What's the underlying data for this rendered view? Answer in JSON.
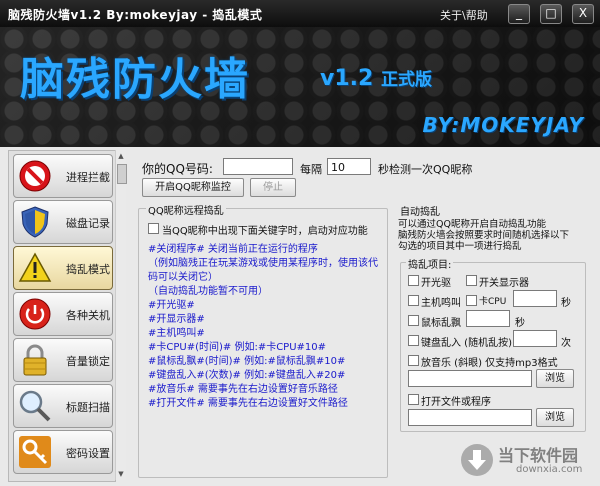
{
  "window": {
    "title": "脑残防火墙v1.2 By:mokeyjay - 捣乱模式",
    "help_label": "关于\\帮助",
    "min_label": "_",
    "max_label": "□",
    "close_label": "X"
  },
  "banner": {
    "logo": "脑残防火墙",
    "version": "v1.2",
    "edition": "正式版",
    "author": "BY:MOKEYJAY"
  },
  "sidebar": {
    "items": [
      {
        "label": "进程拦截",
        "icon": "stop-sign-icon"
      },
      {
        "label": "磁盘记录",
        "icon": "shield-icon"
      },
      {
        "label": "捣乱模式",
        "icon": "warning-icon",
        "selected": true
      },
      {
        "label": "各种关机",
        "icon": "power-icon"
      },
      {
        "label": "音量锁定",
        "icon": "padlock-icon"
      },
      {
        "label": "标题扫描",
        "icon": "magnifier-icon"
      },
      {
        "label": "密码设置",
        "icon": "key-icon"
      }
    ]
  },
  "qq": {
    "label": "你的QQ号码:",
    "value": "",
    "interval_label": "每隔",
    "interval_value": "10",
    "interval_suffix": "秒检测一次QQ昵称",
    "start_button": "开启QQ昵称监控",
    "stop_button": "停止"
  },
  "remote": {
    "title": "QQ昵称远程捣乱",
    "checkbox_label": "当QQ昵称中出现下面关键字时，启动对应功能",
    "lines": [
      "#关闭程序#  关闭当前正在运行的程序",
      "（例如脑残正在玩某游戏或使用某程序时，使用该代",
      "码可以关闭它）",
      "（自动捣乱功能暂不可用）",
      "#开光驱#",
      "#开显示器#",
      "#主机鸣叫#",
      "#卡CPU#(时间)#    例如:#卡CPU#10#",
      "#鼠标乱飘#(时间)#    例如:#鼠标乱飘#10#",
      "#键盘乱入#(次数)#    例如:#键盘乱入#20#",
      "#放音乐#    需要事先在右边设置好音乐路径",
      "#打开文件#    需要事先在右边设置好文件路径"
    ]
  },
  "auto": {
    "title": "自动捣乱",
    "description": [
      "可以通过QQ昵称开启自动捣乱功能",
      "脑残防火墙会按照要求时间随机选择以下",
      "勾选的项目其中一项进行捣乱"
    ],
    "items_title": "捣乱项目:",
    "open_drive": "开光驱",
    "open_monitor": "开关显示器",
    "beep": "主机鸣叫",
    "cpu": "卡CPU",
    "mouse": "鼠标乱飘",
    "keyboard": "键盘乱入 (随机乱按)",
    "seconds_unit": "秒",
    "times_unit": "次",
    "music_label": "放音乐 (斜眼) 仅支持mp3格式",
    "browse": "浏览",
    "open_file_label": "打开文件或程序",
    "cpu_value": "",
    "mouse_value": "",
    "keyboard_value": "",
    "music_path": "",
    "file_path": ""
  },
  "watermark": {
    "text": "当下软件园",
    "url": "downxia.com"
  }
}
